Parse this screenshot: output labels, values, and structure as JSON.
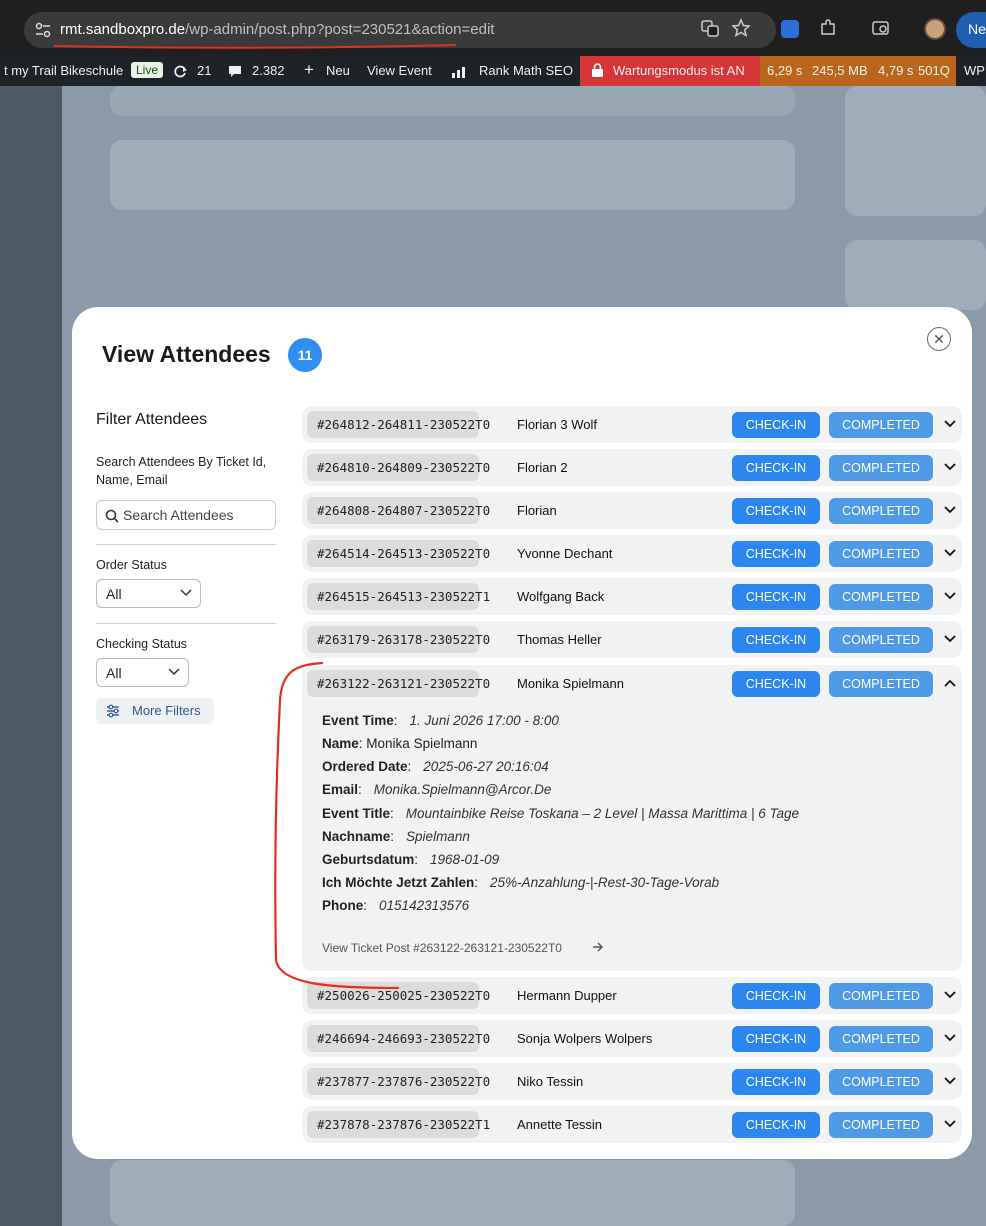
{
  "browser": {
    "url_host": "rmt.sandboxpro.de",
    "url_path": "/wp-admin/post.php?post=230521&action=edit",
    "profile_button_label": "Ne"
  },
  "adminbar": {
    "site_name": "t my Trail Bikeschule",
    "live_badge": "Live",
    "updates_count": "21",
    "comments_count": "2.382",
    "new_label": "Neu",
    "view_event_label": "View Event",
    "rank_math_label": "Rank Math SEO",
    "maintenance_label": "Wartungsmodus ist AN",
    "perf_time": "6,29 s",
    "perf_memory": "245,5 MB",
    "perf_db_time": "4,79 s",
    "perf_queries": "501Q",
    "wp_label": "WP"
  },
  "modal": {
    "title": "View Attendees",
    "count": "11",
    "close_icon": "close-icon"
  },
  "filters": {
    "title": "Filter Attendees",
    "search_label": "Search Attendees By Ticket Id, Name, Email",
    "search_placeholder": "Search Attendees",
    "order_status_label": "Order Status",
    "order_status_value": "All",
    "checking_status_label": "Checking Status",
    "checking_status_value": "All",
    "more_filters_label": "More Filters"
  },
  "attendees": [
    {
      "ticket": "#264812-264811-230522T0",
      "name": "Florian 3 Wolf",
      "checkin": "CHECK-IN",
      "status": "COMPLETED"
    },
    {
      "ticket": "#264810-264809-230522T0",
      "name": "Florian 2",
      "checkin": "CHECK-IN",
      "status": "COMPLETED"
    },
    {
      "ticket": "#264808-264807-230522T0",
      "name": "Florian",
      "checkin": "CHECK-IN",
      "status": "COMPLETED"
    },
    {
      "ticket": "#264514-264513-230522T0",
      "name": "Yvonne Dechant",
      "checkin": "CHECK-IN",
      "status": "COMPLETED"
    },
    {
      "ticket": "#264515-264513-230522T1",
      "name": "Wolfgang Back",
      "checkin": "CHECK-IN",
      "status": "COMPLETED"
    },
    {
      "ticket": "#263179-263178-230522T0",
      "name": "Thomas Heller",
      "checkin": "CHECK-IN",
      "status": "COMPLETED"
    },
    {
      "ticket": "#263122-263121-230522T0",
      "name": "Monika Spielmann",
      "checkin": "CHECK-IN",
      "status": "COMPLETED"
    },
    {
      "ticket": "#250026-250025-230522T0",
      "name": "Hermann Dupper",
      "checkin": "CHECK-IN",
      "status": "COMPLETED"
    },
    {
      "ticket": "#246694-246693-230522T0",
      "name": "Sonja Wolpers Wolpers",
      "checkin": "CHECK-IN",
      "status": "COMPLETED"
    },
    {
      "ticket": "#237877-237876-230522T0",
      "name": "Niko Tessin",
      "checkin": "CHECK-IN",
      "status": "COMPLETED"
    },
    {
      "ticket": "#237878-237876-230522T1",
      "name": "Annette Tessin",
      "checkin": "CHECK-IN",
      "status": "COMPLETED"
    }
  ],
  "expanded": {
    "event_time_label": "Event Time",
    "event_time": "1. Juni 2026 17:00 - 8:00",
    "name_label": "Name",
    "name": "Monika Spielmann",
    "ordered_date_label": "Ordered Date",
    "ordered_date": "2025-06-27 20:16:04",
    "email_label": "Email",
    "email": "Monika.Spielmann@Arcor.De",
    "event_title_label": "Event Title",
    "event_title": "Mountainbike Reise Toskana – 2 Level | Massa Marittima | 6 Tage",
    "nachname_label": "Nachname",
    "nachname": "Spielmann",
    "geburtsdatum_label": "Geburtsdatum",
    "geburtsdatum": "1968-01-09",
    "zahlen_label": "Ich Möchte Jetzt Zahlen",
    "zahlen": "25%-Anzahlung-|-Rest-30-Tage-Vorab",
    "phone_label": "Phone",
    "phone": "015142313576",
    "view_ticket_label": "View Ticket Post #263122-263121-230522T0"
  },
  "colors": {
    "checkin_button": "#2b86ee",
    "status_button": "#4f9ae6",
    "badge": "#2f8ef0",
    "annotation": "#e0301e"
  }
}
